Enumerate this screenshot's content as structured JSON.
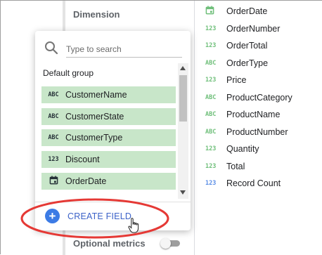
{
  "panel": {
    "dimension_label": "Dimension",
    "optional_metrics_label": "Optional metrics",
    "optional_metrics_enabled": false
  },
  "popup": {
    "search_placeholder": "Type to search",
    "group_label": "Default group",
    "items": [
      {
        "type": "ABC",
        "name": "CustomerName"
      },
      {
        "type": "ABC",
        "name": "CustomerState"
      },
      {
        "type": "ABC",
        "name": "CustomerType"
      },
      {
        "type": "123",
        "name": "Discount"
      },
      {
        "type": "calendar",
        "name": "OrderDate"
      }
    ],
    "create_field_label": "CREATE FIELD"
  },
  "field_list": [
    {
      "type": "calendar",
      "name": "OrderDate"
    },
    {
      "type": "123",
      "name": "OrderNumber"
    },
    {
      "type": "123",
      "name": "OrderTotal"
    },
    {
      "type": "ABC",
      "name": "OrderType"
    },
    {
      "type": "123",
      "name": "Price"
    },
    {
      "type": "ABC",
      "name": "ProductCategory"
    },
    {
      "type": "ABC",
      "name": "ProductName"
    },
    {
      "type": "ABC",
      "name": "ProductNumber"
    },
    {
      "type": "123",
      "name": "Quantity"
    },
    {
      "type": "123",
      "name": "Total"
    },
    {
      "type": "123",
      "name": "Record Count",
      "color": "#5b8ee6"
    }
  ],
  "colors": {
    "dimension_chip": "#c8e6c9",
    "accent": "#3c7be5",
    "annotation": "#e53935"
  }
}
